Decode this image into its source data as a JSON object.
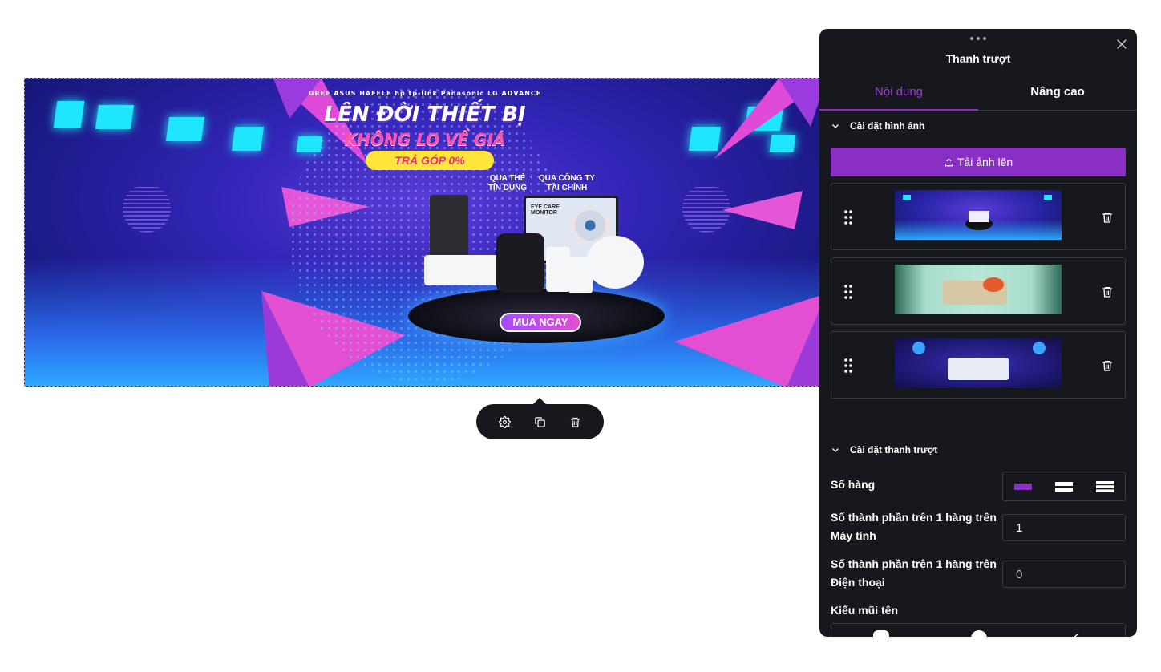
{
  "banner": {
    "brands": "GREE   ASUS   HAFELE   hp   tp-link   Panasonic   LG   ADVANCE",
    "headline": "LÊN ĐỜI THIẾT BỊ",
    "subheadline": "KHÔNG LO VỀ GIÁ",
    "installment": "TRẢ GÓP 0%",
    "option_left": "QUA THẺ\nTÍN DỤNG",
    "option_right": "QUA CÔNG TY\nTÀI CHÍNH",
    "monitor_text": "EYE CARE MONITOR",
    "cta": "MUA NGAY"
  },
  "toolbar": {
    "settings_icon": "gear-icon",
    "duplicate_icon": "copy-icon",
    "delete_icon": "trash-icon"
  },
  "panel": {
    "title": "Thanh trượt",
    "tabs": [
      {
        "label": "Nội dung",
        "active": true
      },
      {
        "label": "Nâng cao",
        "active": false
      }
    ],
    "image_settings": {
      "heading": "Cài đặt hình ảnh",
      "upload_label": "Tải ảnh lên",
      "images": [
        {
          "theme": "blue-neon-electronics"
        },
        {
          "theme": "green-curtain-promo"
        },
        {
          "theme": "purple-balloon-appliances"
        }
      ]
    },
    "slider_settings": {
      "heading": "Cài đặt thanh trượt",
      "rows_label": "Số hàng",
      "rows_selected": 1,
      "desktop_label": "Số thành phần trên 1 hàng trên Máy tính",
      "desktop_value": "1",
      "mobile_label": "Số thành phần trên 1 hàng trên Điện thoại",
      "mobile_value": "0",
      "arrow_label": "Kiểu mũi tên"
    }
  },
  "colors": {
    "accent": "#8a2fc4",
    "tab_active": "#9b3bd6",
    "panel_bg": "#16181d",
    "border": "#3a3d45"
  }
}
